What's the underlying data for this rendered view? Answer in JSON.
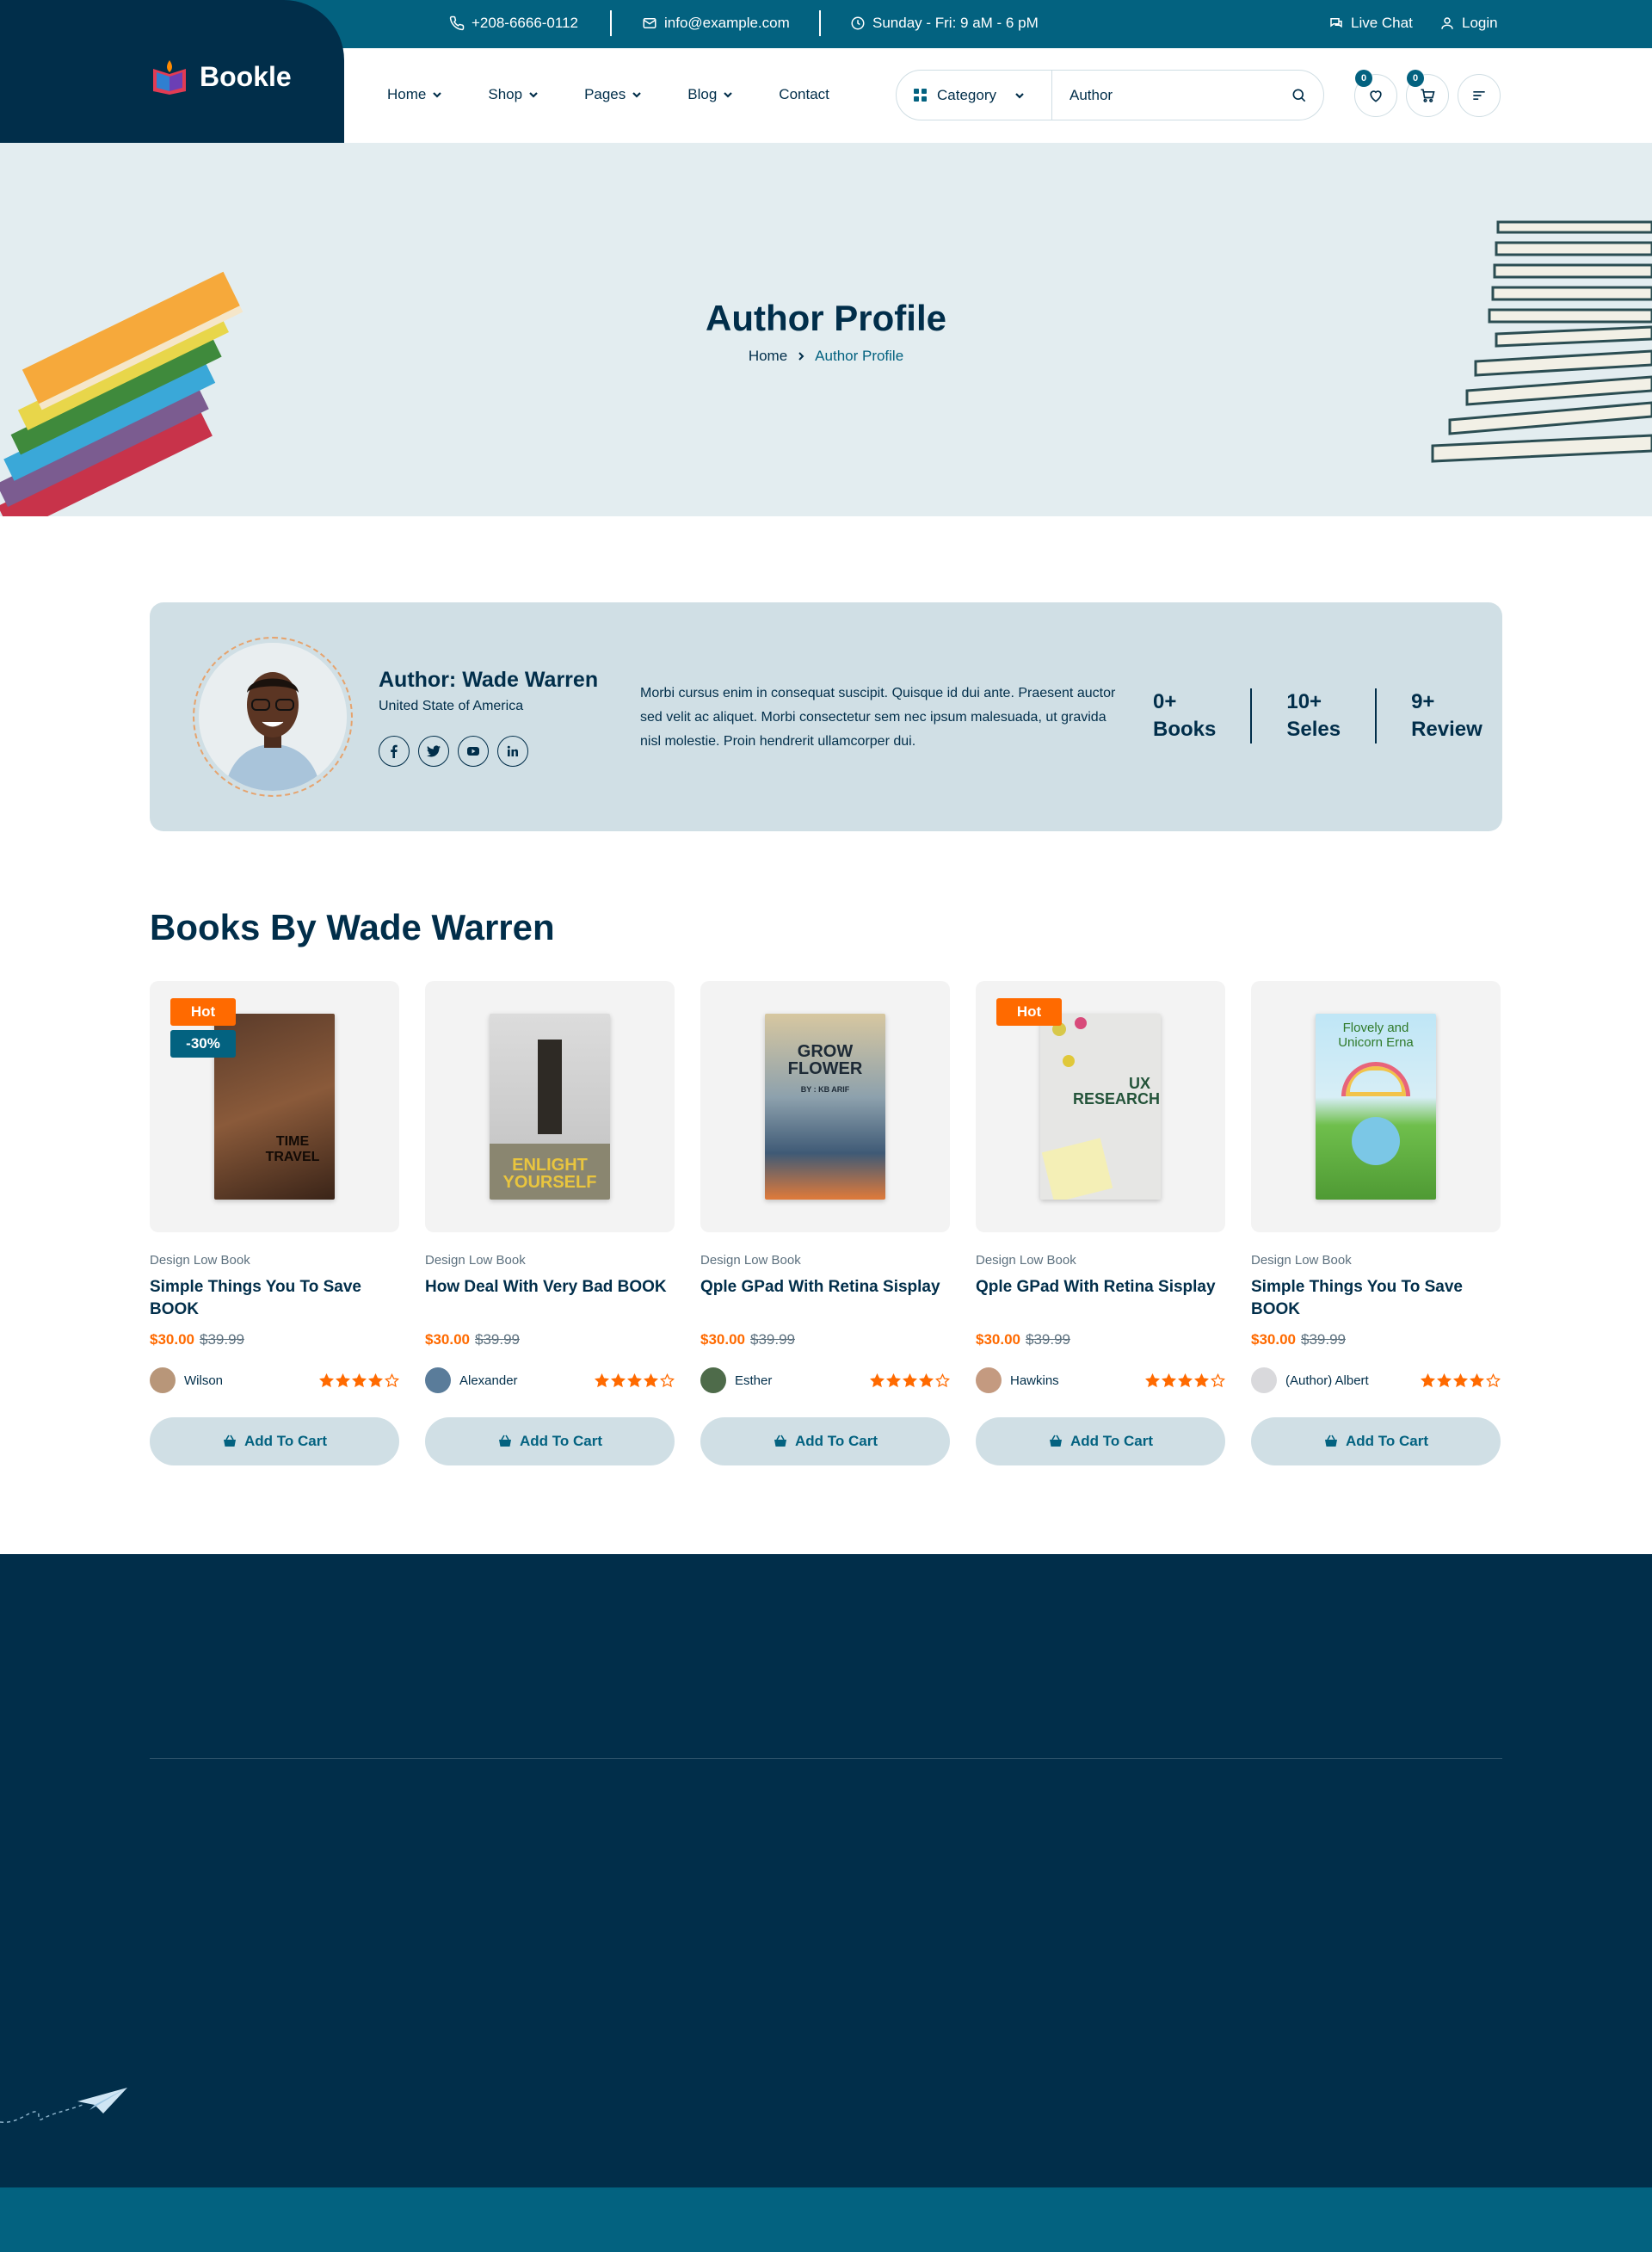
{
  "topbar": {
    "phone": "+208-6666-0112",
    "email": "info@example.com",
    "hours": "Sunday - Fri: 9 aM - 6 pM",
    "live_chat": "Live Chat",
    "login": "Login"
  },
  "brand": {
    "name": "Bookle"
  },
  "nav": {
    "home": "Home",
    "shop": "Shop",
    "pages": "Pages",
    "blog": "Blog",
    "contact": "Contact"
  },
  "search": {
    "category": "Category",
    "value": "Author"
  },
  "header_icons": {
    "wishlist_count": "0",
    "cart_count": "0"
  },
  "hero": {
    "title": "Author Profile",
    "crumb_home": "Home",
    "crumb_current": "Author Profile"
  },
  "author": {
    "name": "Author: Wade Warren",
    "location": "United State of America",
    "bio": "Morbi cursus enim in consequat suscipit. Quisque id dui ante. Praesent auctor sed velit ac aliquet. Morbi consectetur sem nec ipsum malesuada, ut gravida nisl molestie. Proin hendrerit ullamcorper dui.",
    "stats": [
      {
        "value": "0+",
        "label": "Books"
      },
      {
        "value": "10+",
        "label": "Seles"
      },
      {
        "value": "9+",
        "label": "Review"
      }
    ]
  },
  "books_section": {
    "title": "Books By Wade Warren"
  },
  "books": [
    {
      "category": "Design Low Book",
      "title": "Simple Things You To Save BOOK",
      "price": "$30.00",
      "old_price": "$39.99",
      "author": "Wilson",
      "rating": 4,
      "hot": "Hot",
      "discount": "-30%",
      "cover_text": "TIME TRAVEL",
      "cart": "Add To Cart"
    },
    {
      "category": "Design Low Book",
      "title": "How Deal With Very Bad BOOK",
      "price": "$30.00",
      "old_price": "$39.99",
      "author": "Alexander",
      "rating": 4,
      "hot": "",
      "discount": "",
      "cover_text": "ENLIGHT YOURSELF",
      "cart": "Add To Cart"
    },
    {
      "category": "Design Low Book",
      "title": "Qple GPad With Retina Sisplay",
      "price": "$30.00",
      "old_price": "$39.99",
      "author": "Esther",
      "rating": 4,
      "hot": "",
      "discount": "",
      "cover_text": "GROW FLOWER",
      "cover_sub": "BY : KB ARIF",
      "cart": "Add To Cart"
    },
    {
      "category": "Design Low Book",
      "title": "Qple GPad With Retina Sisplay",
      "price": "$30.00",
      "old_price": "$39.99",
      "author": "Hawkins",
      "rating": 4,
      "hot": "Hot",
      "discount": "",
      "cover_text": "UX RESEARCH",
      "cart": "Add To Cart"
    },
    {
      "category": "Design Low Book",
      "title": "Simple Things You To Save BOOK",
      "price": "$30.00",
      "old_price": "$39.99",
      "author": "(Author) Albert",
      "rating": 4,
      "hot": "",
      "discount": "",
      "cover_text": "Flovely and Unicorn Erna",
      "cart": "Add To Cart"
    }
  ],
  "colors": {
    "navy": "#012e4a",
    "teal": "#036280",
    "accent": "#ff6a00",
    "hero_bg": "#e3edf0",
    "card_bg": "#d0dfe5"
  }
}
